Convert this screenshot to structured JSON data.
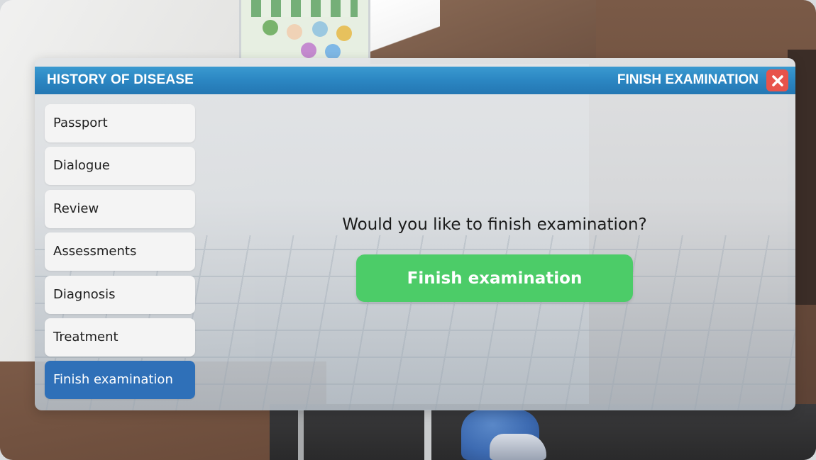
{
  "header": {
    "title": "HISTORY OF DISEASE",
    "finish_label": "FINISH EXAMINATION",
    "close_icon": "close-icon"
  },
  "sidebar": {
    "items": [
      {
        "label": "Passport",
        "active": false
      },
      {
        "label": "Dialogue",
        "active": false
      },
      {
        "label": "Review",
        "active": false
      },
      {
        "label": "Assessments",
        "active": false
      },
      {
        "label": "Diagnosis",
        "active": false
      },
      {
        "label": "Treatment",
        "active": false
      },
      {
        "label": "Finish examination",
        "active": true
      }
    ]
  },
  "main": {
    "question": "Would you like to finish examination?",
    "confirm_label": "Finish examination"
  },
  "colors": {
    "header_blue": "#2b86c2",
    "active_item": "#2f70b8",
    "confirm_green": "#4ccc68",
    "close_red": "#e8534b"
  }
}
